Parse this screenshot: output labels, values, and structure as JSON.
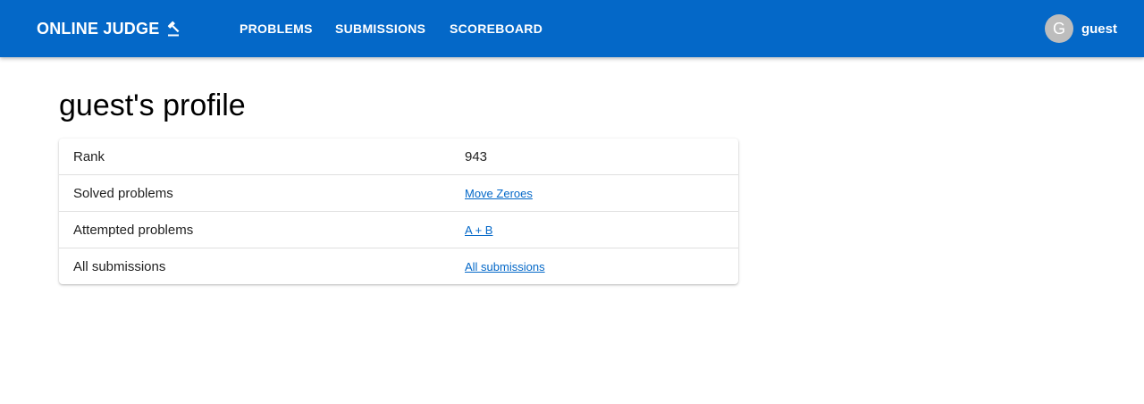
{
  "header": {
    "brand": "ONLINE JUDGE",
    "brand_icon": "gavel-icon",
    "nav": {
      "problems": "PROBLEMS",
      "submissions": "SUBMISSIONS",
      "scoreboard": "SCOREBOARD"
    },
    "user": {
      "avatar_letter": "G",
      "name": "guest"
    }
  },
  "page": {
    "title": "guest's profile"
  },
  "profile": {
    "rank_label": "Rank",
    "rank_value": "943",
    "solved_label": "Solved problems",
    "solved_link": "Move Zeroes",
    "attempted_label": "Attempted problems",
    "attempted_link": "A + B",
    "all_label": "All submissions",
    "all_link": "All submissions"
  },
  "colors": {
    "primary": "#0468c8",
    "avatar_bg": "#bdbdbd"
  }
}
